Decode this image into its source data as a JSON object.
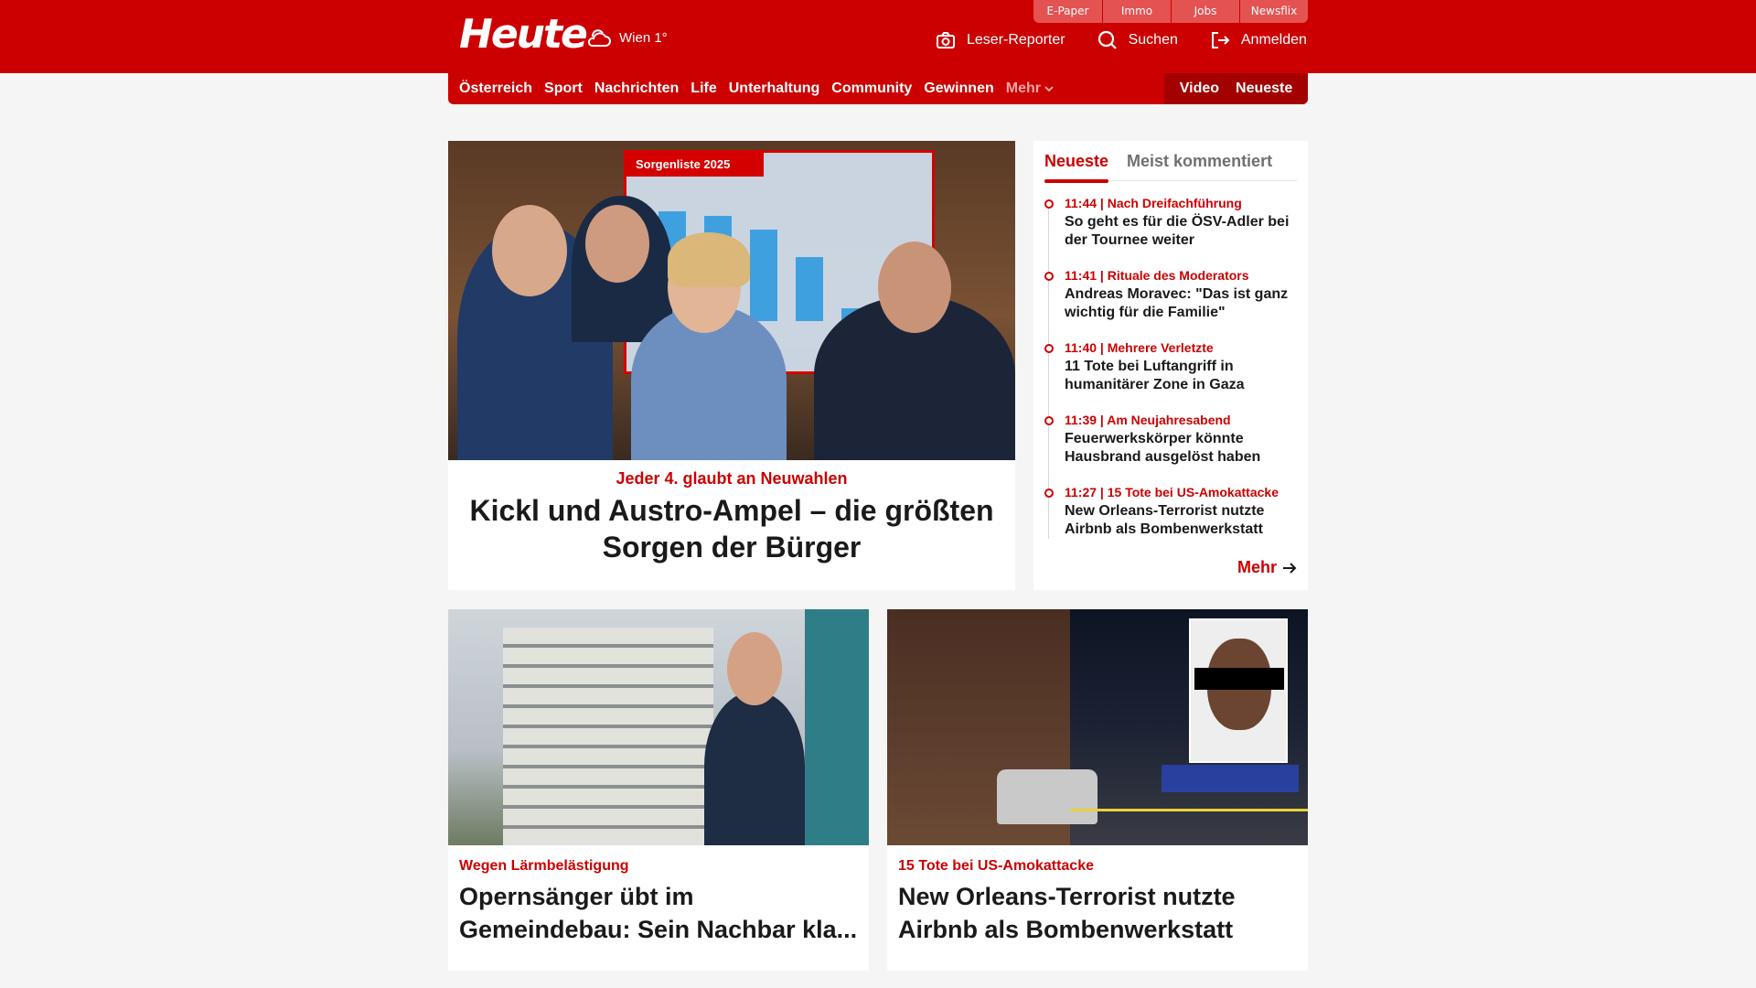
{
  "top_links": [
    "E-Paper",
    "Immo",
    "Jobs",
    "Newsflix"
  ],
  "brand": {
    "logo": "Heute",
    "weather": "Wien 1°",
    "weather_icon": "cloud-sun-icon"
  },
  "actions": [
    {
      "label": "Leser-Reporter",
      "icon": "camera-icon"
    },
    {
      "label": "Suchen",
      "icon": "search-icon"
    },
    {
      "label": "Anmelden",
      "icon": "login-icon"
    }
  ],
  "nav": {
    "items": [
      "Österreich",
      "Sport",
      "Nachrichten",
      "Life",
      "Unterhaltung",
      "Community",
      "Gewinnen"
    ],
    "more": "Mehr",
    "right": [
      "Video",
      "Neueste"
    ]
  },
  "hero": {
    "image_caption": "Sorgenliste 2025",
    "kicker": "Jeder 4. glaubt an Neuwahlen",
    "title": "Kickl und Austro-Ampel – die größten Sorgen der Bürger"
  },
  "sidebar": {
    "tabs": [
      "Neueste",
      "Meist kommentiert"
    ],
    "items": [
      {
        "time": "11:44",
        "tag": "Nach Dreifachführung",
        "meta": "11:44 | Nach Dreifachführung",
        "title": "So geht es für die ÖSV-Adler bei der Tournee weiter"
      },
      {
        "time": "11:41",
        "tag": "Rituale des Moderators",
        "meta": "11:41 | Rituale des Moderators",
        "title": "Andreas Moravec: \"Das ist ganz wichtig für die Familie\""
      },
      {
        "time": "11:40",
        "tag": "Mehrere Verletzte",
        "meta": "11:40 | Mehrere Verletzte",
        "title": "11 Tote bei Luftangriff in humanitärer Zone in Gaza"
      },
      {
        "time": "11:39",
        "tag": "Am Neujahresabend",
        "meta": "11:39 | Am Neujahresabend",
        "title": "Feuerwerkskörper könnte Hausbrand ausgelöst haben"
      },
      {
        "time": "11:27",
        "tag": "15 Tote bei US-Amokattacke",
        "meta": "11:27 | 15 Tote bei US-Amokattacke",
        "title": "New Orleans-Terrorist nutzte Airbnb als Bombenwerkstatt"
      }
    ],
    "more": "Mehr"
  },
  "cards": [
    {
      "kicker": "Wegen Lärmbelästigung",
      "title_line1": "Opernsänger übt im",
      "title_line2": "Gemeindebau: Sein Nachbar kla..."
    },
    {
      "kicker": "15 Tote bei US-Amokattacke",
      "title_line1": "New Orleans-Terrorist nutzte",
      "title_line2": "Airbnb als Bombenwerkstatt"
    }
  ],
  "colors": {
    "brand_red": "#cc0000",
    "dark_red": "#a30000",
    "background": "#f5f5f5"
  }
}
